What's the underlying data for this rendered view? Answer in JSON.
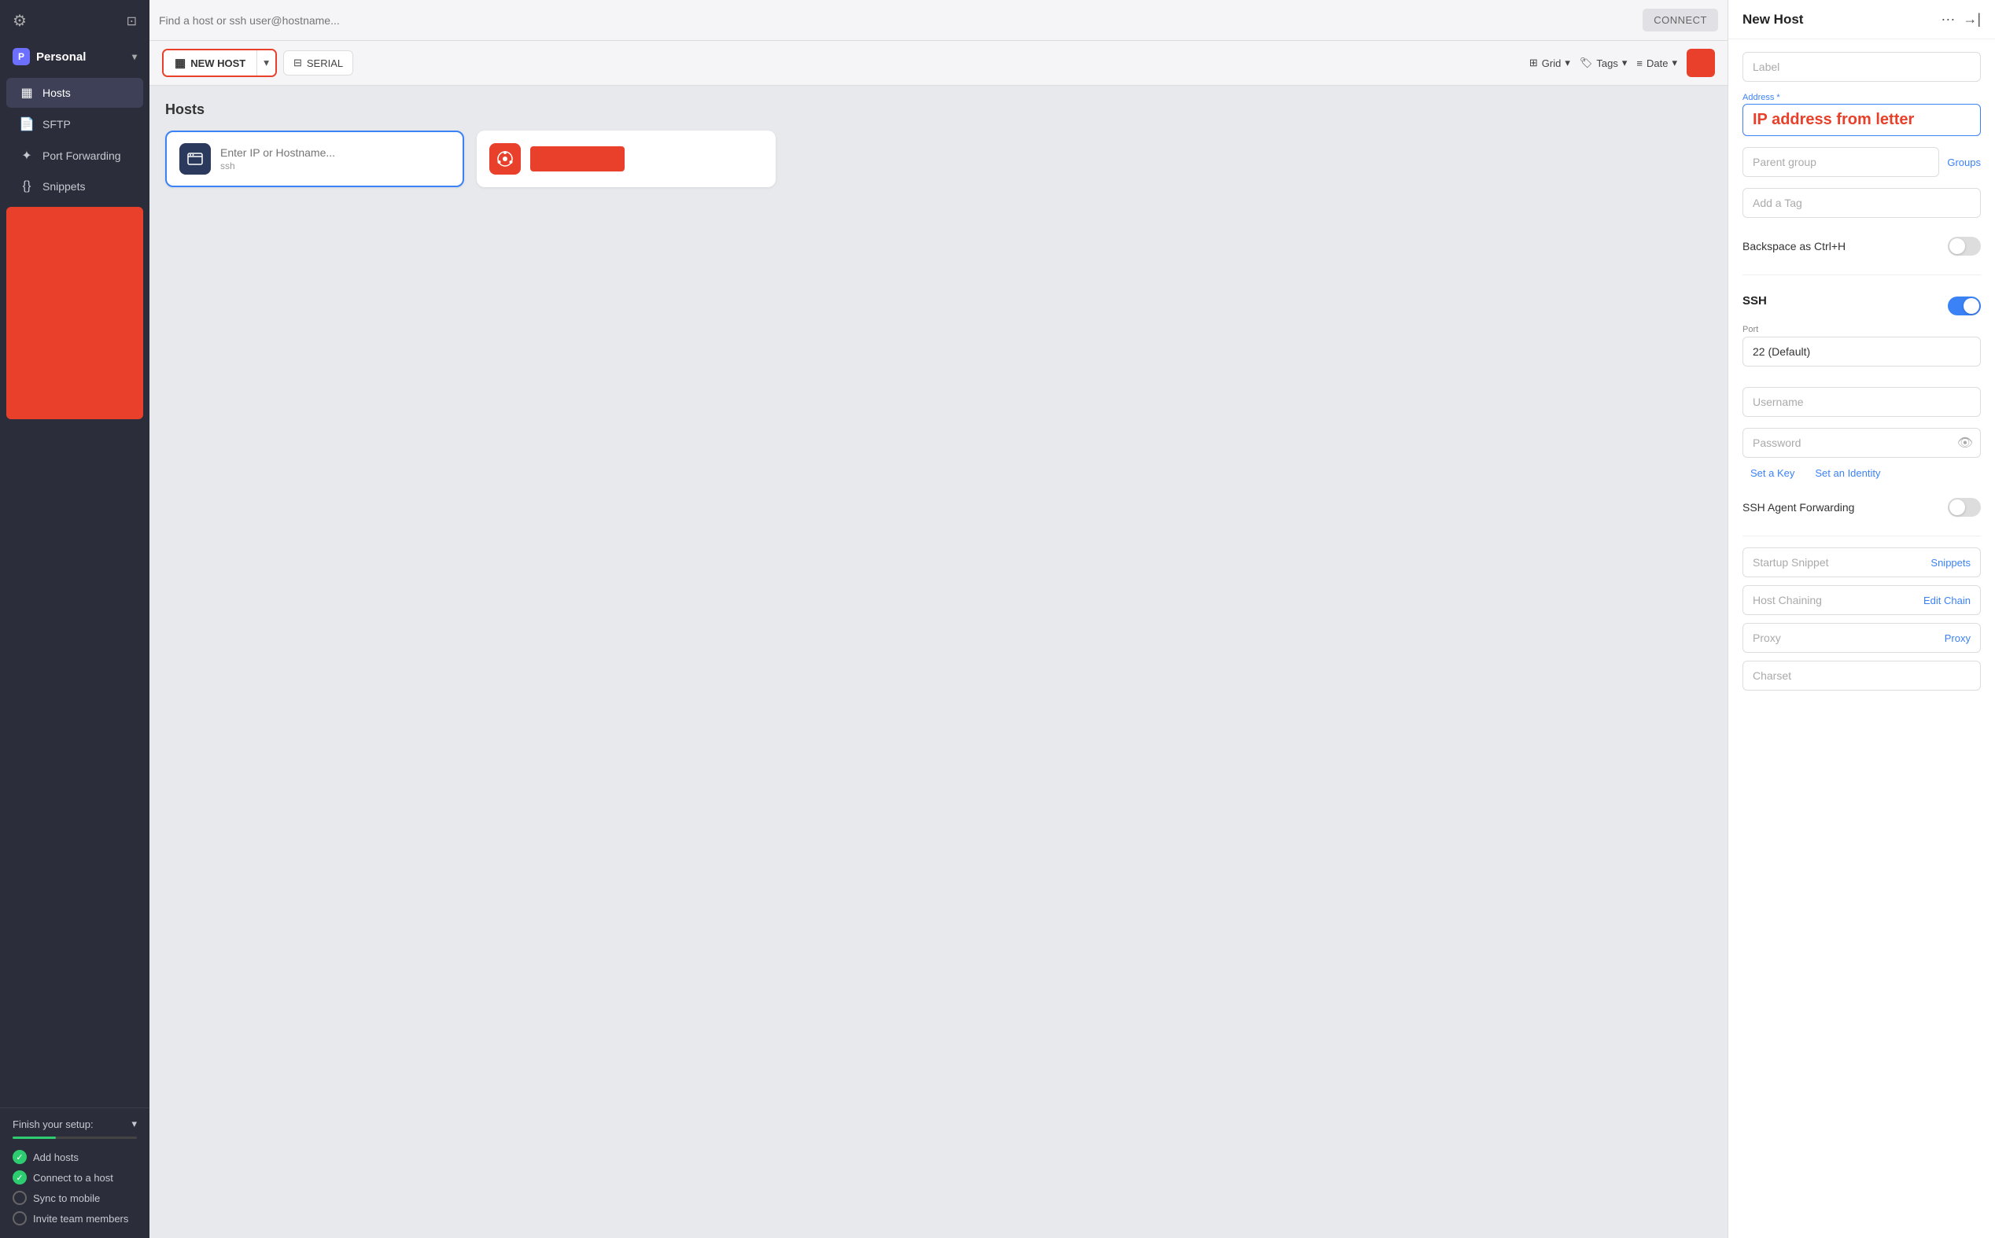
{
  "sidebar": {
    "gear_icon": "⚙",
    "terminal_icon": "⊡",
    "workspace": {
      "label": "Personal",
      "chevron": "▾"
    },
    "nav_items": [
      {
        "id": "hosts",
        "icon": "▦",
        "label": "Hosts",
        "active": true
      },
      {
        "id": "sftp",
        "icon": "📄",
        "label": "SFTP",
        "active": false
      },
      {
        "id": "port-forwarding",
        "icon": "✦",
        "label": "Port Forwarding",
        "active": false
      },
      {
        "id": "snippets",
        "icon": "{}",
        "label": "Snippets",
        "active": false
      }
    ],
    "setup": {
      "header": "Finish your setup:",
      "chevron": "▾",
      "items": [
        {
          "label": "Add hosts",
          "status": "done"
        },
        {
          "label": "Connect to a host",
          "status": "active"
        },
        {
          "label": "Sync to mobile",
          "status": "empty"
        },
        {
          "label": "Invite team members",
          "status": "empty"
        }
      ]
    }
  },
  "search": {
    "placeholder": "Find a host or ssh user@hostname...",
    "connect_label": "CONNECT"
  },
  "toolbar": {
    "new_host_label": "NEW HOST",
    "serial_label": "SERIAL",
    "grid_label": "Grid",
    "tags_label": "Tags",
    "date_label": "Date"
  },
  "hosts_section": {
    "title": "Hosts",
    "new_host_card": {
      "placeholder": "Enter IP or Hostname...",
      "sub": "ssh"
    },
    "ubuntu_card": {
      "name": ""
    }
  },
  "right_panel": {
    "title": "New Host",
    "label_placeholder": "Label",
    "address_label": "Address *",
    "address_value": "IP address from letter",
    "parent_group_placeholder": "Parent group",
    "groups_link": "Groups",
    "tag_placeholder": "Add a Tag",
    "backspace_ctrl_h": "Backspace as Ctrl+H",
    "ssh_section": "SSH",
    "ssh_toggle_on": true,
    "port_label": "Port",
    "port_value": "22 (Default)",
    "username_placeholder": "Username",
    "password_placeholder": "Password",
    "set_key_link": "Set a Key",
    "set_identity_link": "Set an Identity",
    "ssh_agent_forwarding": "SSH Agent Forwarding",
    "startup_snippet_placeholder": "Startup Snippet",
    "snippets_link": "Snippets",
    "host_chaining_placeholder": "Host Chaining",
    "edit_chain_link": "Edit Chain",
    "proxy_placeholder": "Proxy",
    "proxy_link": "Proxy",
    "charset_placeholder": "Charset"
  }
}
